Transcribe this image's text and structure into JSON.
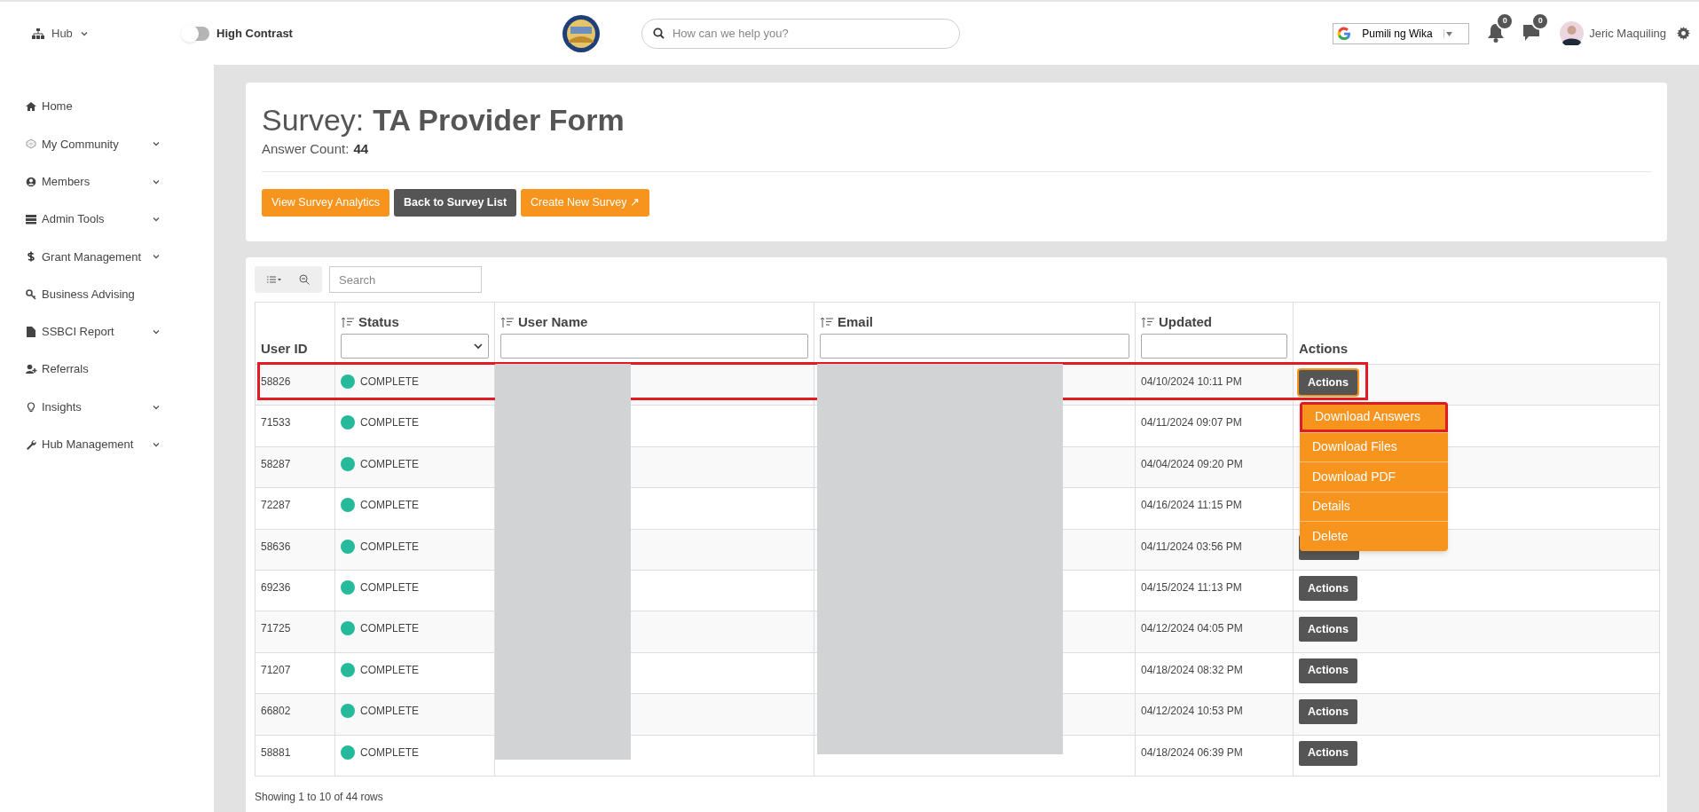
{
  "header": {
    "hub_label": "Hub",
    "contrast_toggle": {
      "label": "High Contrast",
      "on": false
    },
    "search": {
      "placeholder": "How can we help you?"
    },
    "language": "Pumili ng Wika",
    "notifications": "0",
    "messages": "0",
    "user_name": "Jeric Maquiling"
  },
  "sidebar": {
    "items": [
      {
        "label": "Home",
        "expandable": false
      },
      {
        "label": "My Community",
        "expandable": true
      },
      {
        "label": "Members",
        "expandable": true
      },
      {
        "label": "Admin Tools",
        "expandable": true
      },
      {
        "label": "Grant Management",
        "expandable": true
      },
      {
        "label": "Business Advising",
        "expandable": false
      },
      {
        "label": "SSBCI Report",
        "expandable": true
      },
      {
        "label": "Referrals",
        "expandable": false
      },
      {
        "label": "Insights",
        "expandable": true
      },
      {
        "label": "Hub Management",
        "expandable": true
      }
    ]
  },
  "survey": {
    "label": "Survey:",
    "name": "TA Provider Form",
    "count_label": "Answer Count:",
    "count": "44",
    "buttons": [
      {
        "label": "View Survey Analytics",
        "kind": "primary"
      },
      {
        "label": "Back to Survey List",
        "kind": "dark"
      },
      {
        "label": "Create New Survey ↗",
        "kind": "primary"
      }
    ]
  },
  "table": {
    "search_placeholder": "Search",
    "columns": [
      {
        "label": "User ID",
        "sortable": false,
        "kind": "plain"
      },
      {
        "label": "Status",
        "sortable": true,
        "kind": "select"
      },
      {
        "label": "User Name",
        "sortable": true,
        "kind": "text"
      },
      {
        "label": "Email",
        "sortable": true,
        "kind": "text"
      },
      {
        "label": "Updated",
        "sortable": true,
        "kind": "text"
      },
      {
        "label": "Actions",
        "sortable": false,
        "kind": "plain"
      }
    ],
    "rows": [
      {
        "user_id": "58826",
        "status": "COMPLETE",
        "color": "#26b99a",
        "updated": "04/10/2024 10:11 PM",
        "kind": "full",
        "action": "Actions",
        "highlighted": true
      },
      {
        "user_id": "71533",
        "status": "COMPLETE",
        "color": "#26b99a",
        "updated": "04/11/2024 09:07 PM",
        "kind": "hidden",
        "highlighted": false
      },
      {
        "user_id": "58287",
        "status": "COMPLETE",
        "color": "#26b99a",
        "updated": "04/04/2024 09:20 PM",
        "kind": "hidden",
        "highlighted": false
      },
      {
        "user_id": "72287",
        "status": "COMPLETE",
        "color": "#26b99a",
        "updated": "04/16/2024 11:15 PM",
        "kind": "hidden",
        "highlighted": false
      },
      {
        "user_id": "58636",
        "status": "COMPLETE",
        "color": "#26b99a",
        "updated": "04/11/2024 03:56 PM",
        "kind": "covered",
        "highlighted": false
      },
      {
        "user_id": "69236",
        "status": "COMPLETE",
        "color": "#26b99a",
        "updated": "04/15/2024 11:13 PM",
        "kind": "full",
        "action": "Actions",
        "highlighted": false
      },
      {
        "user_id": "71725",
        "status": "COMPLETE",
        "color": "#26b99a",
        "updated": "04/12/2024 04:05 PM",
        "kind": "full",
        "action": "Actions",
        "highlighted": false
      },
      {
        "user_id": "71207",
        "status": "COMPLETE",
        "color": "#26b99a",
        "updated": "04/18/2024 08:32 PM",
        "kind": "full",
        "action": "Actions",
        "highlighted": false
      },
      {
        "user_id": "66802",
        "status": "COMPLETE",
        "color": "#26b99a",
        "updated": "04/12/2024 10:53 PM",
        "kind": "full",
        "action": "Actions",
        "highlighted": false
      },
      {
        "user_id": "58881",
        "status": "COMPLETE",
        "color": "#26b99a",
        "updated": "04/18/2024 06:39 PM",
        "kind": "full",
        "action": "Actions",
        "highlighted": false
      }
    ],
    "menu": [
      {
        "label": "Download Answers",
        "highlighted": true
      },
      {
        "label": "Download Files",
        "highlighted": false
      },
      {
        "label": "Download PDF",
        "highlighted": false
      },
      {
        "label": "Details",
        "highlighted": false
      },
      {
        "label": "Delete",
        "highlighted": false
      }
    ],
    "footer": "Showing 1 to 10 of 44 rows"
  }
}
